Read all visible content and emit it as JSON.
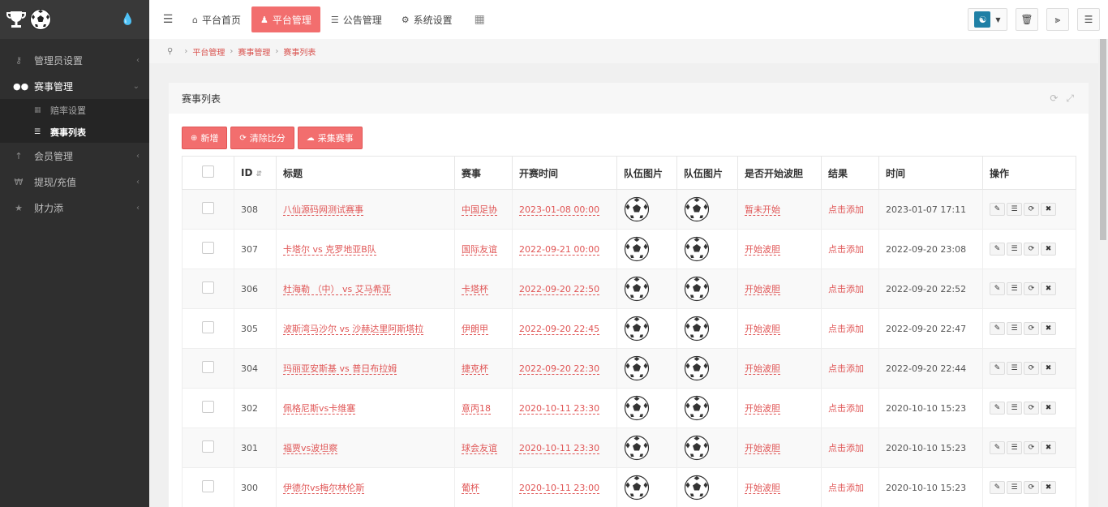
{
  "sidebar": {
    "items": [
      {
        "label": "管理员设置",
        "icon": "key-icon"
      },
      {
        "label": "赛事管理",
        "icon": "users-icon",
        "open": true
      },
      {
        "label": "会员管理",
        "icon": "user-icon"
      },
      {
        "label": "提现/充值",
        "icon": "yen-icon"
      },
      {
        "label": "财力添",
        "icon": "star-icon"
      }
    ],
    "subitems": [
      {
        "label": "赔率设置"
      },
      {
        "label": "赛事列表",
        "active": true
      }
    ]
  },
  "topbar": {
    "tabs": [
      {
        "label": "平台首页"
      },
      {
        "label": "平台管理"
      },
      {
        "label": "公告管理"
      },
      {
        "label": "系统设置"
      }
    ]
  },
  "breadcrumb": [
    "平台管理",
    "赛事管理",
    "赛事列表"
  ],
  "panel": {
    "title": "赛事列表",
    "buttons": {
      "add": "新增",
      "clear": "清除比分",
      "collect": "采集赛事"
    }
  },
  "table": {
    "headers": {
      "id": "ID",
      "title": "标题",
      "league": "赛事",
      "start": "开赛时间",
      "team1": "队伍图片",
      "team2": "队伍图片",
      "started": "是否开始波胆",
      "result": "结果",
      "time": "时间",
      "ops": "操作"
    },
    "rows": [
      {
        "id": "308",
        "title": "八仙源码网测试赛事",
        "league": "中国足协",
        "start": "2023-01-08 00:00",
        "started": "暂未开始",
        "result": "点击添加",
        "time": "2023-01-07 17:11"
      },
      {
        "id": "307",
        "title": "卡塔尔 vs 克罗地亚B队",
        "league": "国际友谊",
        "start": "2022-09-21 00:00",
        "started": "开始波胆",
        "result": "点击添加",
        "time": "2022-09-20 23:08"
      },
      {
        "id": "306",
        "title": "杜海勒 （中） vs 艾马希亚",
        "league": "卡塔杯",
        "start": "2022-09-20 22:50",
        "started": "开始波胆",
        "result": "点击添加",
        "time": "2022-09-20 22:52"
      },
      {
        "id": "305",
        "title": "波斯湾马沙尔 vs 沙赫达里阿斯塔拉",
        "league": "伊朗甲",
        "start": "2022-09-20 22:45",
        "started": "开始波胆",
        "result": "点击添加",
        "time": "2022-09-20 22:47"
      },
      {
        "id": "304",
        "title": "玛丽亚安斯基 vs 普日布拉姆",
        "league": "捷克杯",
        "start": "2022-09-20 22:30",
        "started": "开始波胆",
        "result": "点击添加",
        "time": "2022-09-20 22:44"
      },
      {
        "id": "302",
        "title": "佩格尼斯vs卡维塞",
        "league": "意丙18",
        "start": "2020-10-11 23:30",
        "started": "开始波胆",
        "result": "点击添加",
        "time": "2020-10-10 15:23"
      },
      {
        "id": "301",
        "title": "福贾vs波坦察",
        "league": "球会友谊",
        "start": "2020-10-11 23:30",
        "started": "开始波胆",
        "result": "点击添加",
        "time": "2020-10-10 15:23"
      },
      {
        "id": "300",
        "title": "伊德尔vs梅尔林伦斯",
        "league": "葡杯",
        "start": "2020-10-11 23:00",
        "started": "开始波胆",
        "result": "点击添加",
        "time": "2020-10-10 15:23"
      }
    ]
  },
  "colors": {
    "accent": "#f26e6e",
    "sidebar": "#2f2f2f",
    "link": "#e05555"
  }
}
